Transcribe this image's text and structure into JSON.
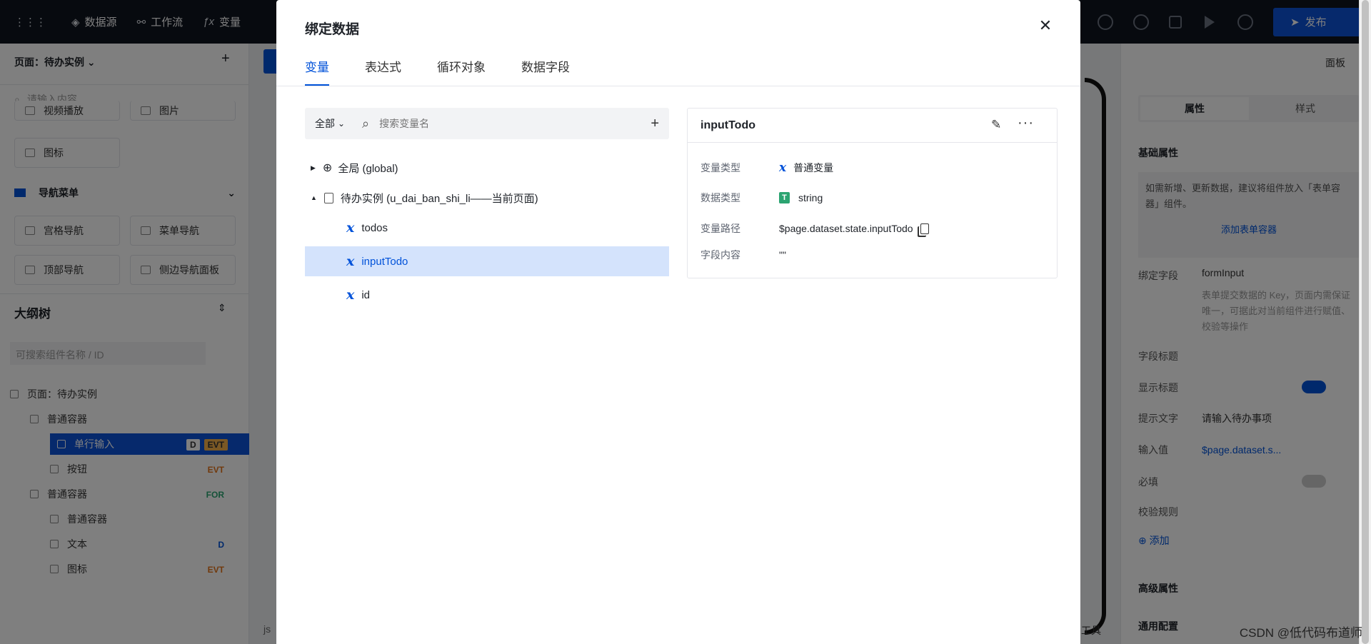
{
  "topbar": {
    "items": [
      {
        "icon": "grid-icon",
        "label": ""
      },
      {
        "icon": "database-icon",
        "label": "数据源"
      },
      {
        "icon": "workflow-icon",
        "label": "工作流"
      },
      {
        "icon": "function-icon",
        "label": "变量"
      }
    ],
    "publish_label": "发布"
  },
  "left_panel": {
    "page_selector": "页面：待办实例",
    "search_placeholder": "请输入内容",
    "components_top": [
      "视频播放",
      "图片"
    ],
    "component_icon_label": "图标",
    "nav_section_title": "导航菜单",
    "nav_components": [
      "宫格导航",
      "菜单导航",
      "顶部导航",
      "侧边导航面板"
    ],
    "outline_title": "大纲树",
    "outline_search_placeholder": "可搜索组件名称 / ID",
    "outline": [
      {
        "label": "页面：待办实例",
        "indent": 0,
        "tags": []
      },
      {
        "label": "普通容器",
        "indent": 1,
        "tags": []
      },
      {
        "label": "单行输入",
        "indent": 2,
        "tags": [
          "D",
          "EVT"
        ],
        "selected": true
      },
      {
        "label": "按钮",
        "indent": 2,
        "tags": [
          "EVT"
        ]
      },
      {
        "label": "普通容器",
        "indent": 1,
        "tags": [
          "FOR"
        ]
      },
      {
        "label": "普通容器",
        "indent": 2,
        "tags": []
      },
      {
        "label": "文本",
        "indent": 2,
        "tags": [
          "D"
        ]
      },
      {
        "label": "图标",
        "indent": 2,
        "tags": [
          "EVT"
        ]
      }
    ]
  },
  "right_panel": {
    "panel_label": "面板",
    "tabs": [
      "属性",
      "样式"
    ],
    "section_basic": "基础属性",
    "hint": "如需新增、更新数据，建议将组件放入「表单容器」组件。",
    "add_form_container": "添加表单容器",
    "fields": {
      "bind_field_label": "绑定字段",
      "bind_field_value": "formInput",
      "bind_field_hint": "表单提交数据的 Key，页面内需保证唯一，可据此对当前组件进行赋值、校验等操作",
      "field_title_label": "字段标题",
      "show_title_label": "显示标题",
      "hint_text_label": "提示文字",
      "hint_text_value": "请输入待办事项",
      "input_value_label": "输入值",
      "input_value_value": "$page.dataset.s...",
      "required_label": "必填",
      "validation_label": "校验规则",
      "add_label": "添加"
    },
    "section_advanced": "高级属性",
    "section_common": "通用配置"
  },
  "bottom_left_text": "js",
  "bottom_right_text": "工具",
  "modal": {
    "title": "绑定数据",
    "tabs": [
      "变量",
      "表达式",
      "循环对象",
      "数据字段"
    ],
    "active_tab": 0,
    "filter": {
      "scope_label": "全部",
      "search_placeholder": "搜索变量名"
    },
    "tree": {
      "global_label": "全局 (global)",
      "page_label": "待办实例 (u_dai_ban_shi_li——当前页面)",
      "variables": [
        "todos",
        "inputTodo",
        "id"
      ],
      "selected_index": 1
    },
    "detail": {
      "name": "inputTodo",
      "rows": [
        {
          "key": "变量类型",
          "value": "普通变量",
          "icon": "variable-x-icon"
        },
        {
          "key": "数据类型",
          "value": "string",
          "icon": "string-type-icon"
        },
        {
          "key": "变量路径",
          "value": "$page.dataset.state.inputTodo",
          "icon": "copy-icon"
        },
        {
          "key": "字段内容",
          "value": "\"\"",
          "icon": ""
        }
      ]
    }
  },
  "watermark": "CSDN @低代码布道师",
  "colors": {
    "accent": "#0052d9",
    "topbar": "#0f141e",
    "selected_row": "#d4e3fc",
    "tag_evt": "#e37318",
    "tag_for": "#2ba471",
    "tag_d": "#0052d9"
  }
}
